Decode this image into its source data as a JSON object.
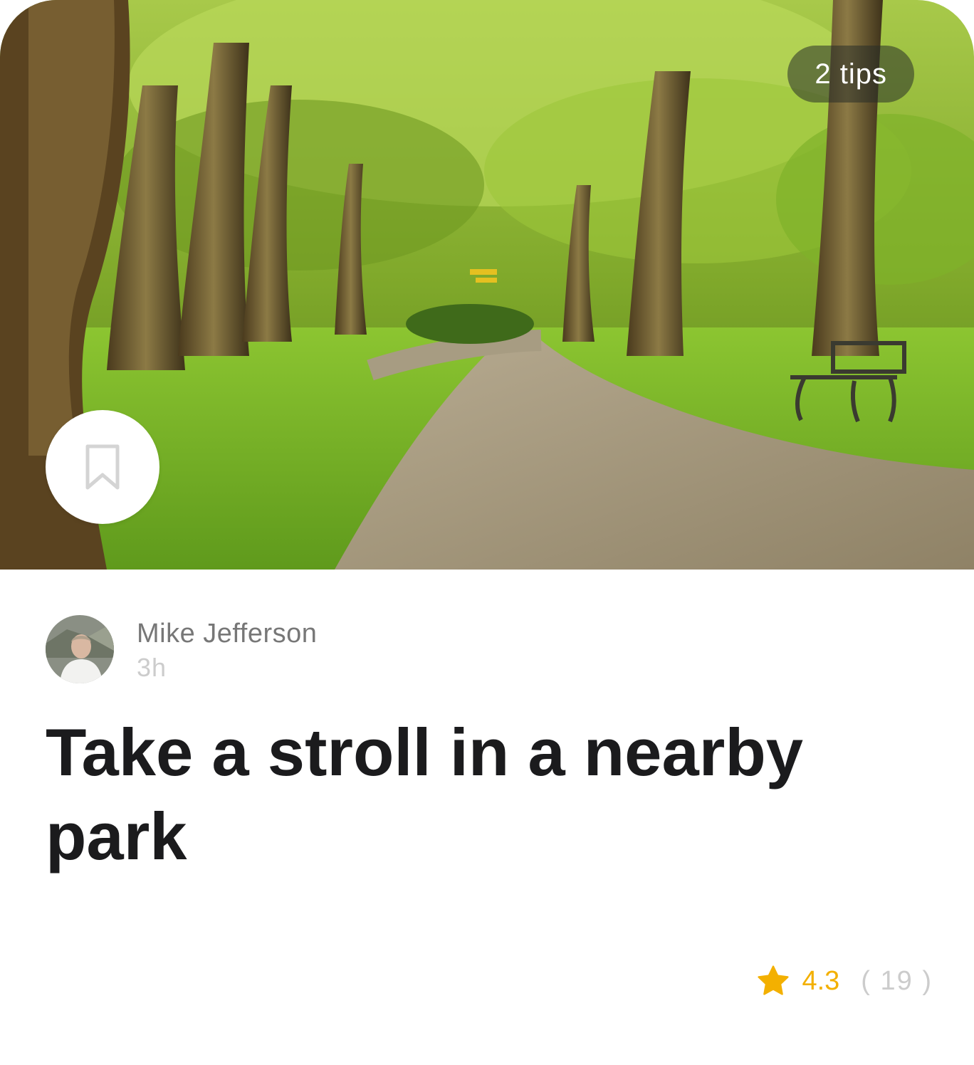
{
  "hero": {
    "tips_label": "2 tips",
    "bookmark_icon": "bookmark-icon"
  },
  "author": {
    "name": "Mike Jefferson",
    "time": "3h"
  },
  "post": {
    "title": "Take a stroll in a nearby park"
  },
  "rating": {
    "icon": "star-icon",
    "value": "4.3",
    "count": "( 19 )"
  },
  "colors": {
    "title": "#1b1b1d",
    "accent_star": "#f3b000",
    "muted_text": "#777777",
    "light_text": "#cccccc"
  }
}
